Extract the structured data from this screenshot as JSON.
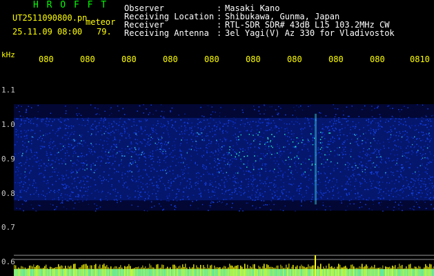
{
  "header": {
    "station_code": "H R O F F T",
    "filename": "UT2511090800.pn",
    "tag": "meteor",
    "date_time": "25.11.09 08:00",
    "count": "79.",
    "info": [
      {
        "label": "Observer",
        "sep": ":",
        "value": "Masaki Kano"
      },
      {
        "label": "Receiving Location",
        "sep": ":",
        "value": "Shibukawa, Gunma, Japan"
      },
      {
        "label": "Receiver",
        "sep": ":",
        "value": "RTL-SDR SDR# 43dB L15 103.2MHz CW"
      },
      {
        "label": "Receiving Antenna",
        "sep": ":",
        "value": "3el Yagi(V) Az 330 for Vladivostok"
      }
    ]
  },
  "axes": {
    "y_unit": "kHz",
    "x_ticks": [
      "080",
      "080",
      "080",
      "080",
      "080",
      "080",
      "080",
      "080",
      "080",
      "0810"
    ],
    "y_ticks": [
      "1.1",
      "1.0",
      "0.9",
      "0.8",
      "0.7",
      "0.6"
    ]
  },
  "colors": {
    "background": "#000000",
    "text_white": "#ffffff",
    "text_yellow": "#ffff00",
    "text_green": "#00ff00",
    "signal_band": "#0a28b4",
    "signal_bright": "#22e6c8",
    "baseline": "#00d8ff"
  },
  "chart_data": {
    "type": "heatmap",
    "y_range_khz": [
      0.55,
      1.15
    ],
    "signal_band_khz": [
      0.78,
      1.02
    ],
    "strong_band_khz": [
      0.86,
      0.98
    ],
    "meteor_spike_x_index": 7
  }
}
